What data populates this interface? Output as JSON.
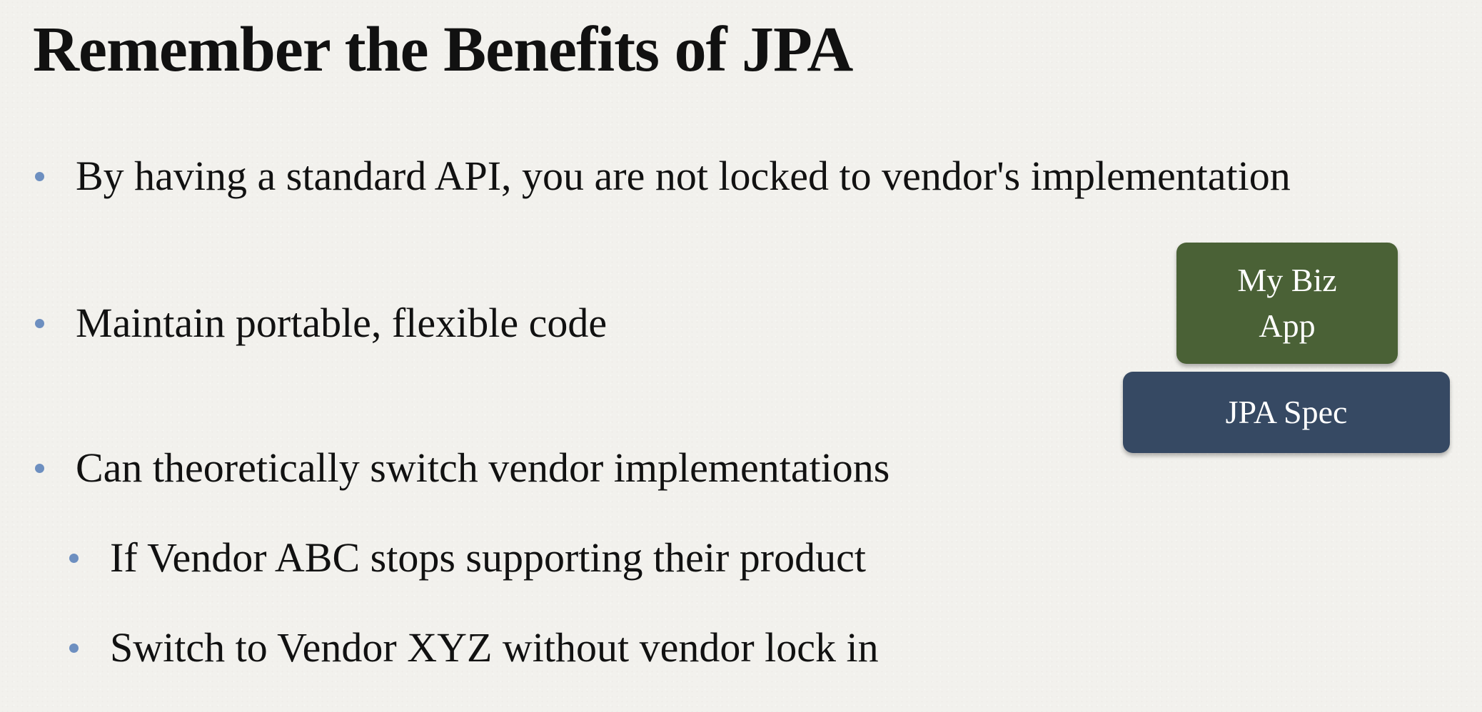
{
  "slide": {
    "title": "Remember the Benefits of JPA",
    "bullets": [
      {
        "text": "By having a standard API, you are not locked to vendor's implementation",
        "level": 1
      },
      {
        "text": "Maintain portable, flexible code",
        "level": 1
      },
      {
        "text": "Can theoretically switch vendor implementations",
        "level": 1
      },
      {
        "text": "If Vendor ABC stops supporting their product",
        "level": 2
      },
      {
        "text": "Switch to Vendor XYZ without vendor lock in",
        "level": 2
      }
    ],
    "diagram": {
      "app_box": "My Biz\nApp",
      "spec_box": "JPA Spec"
    }
  },
  "colors": {
    "background": "#f2f1ed",
    "bullet": "#6d8fc0",
    "app_box": "#4a6136",
    "spec_box": "#364963",
    "text": "#111111"
  }
}
